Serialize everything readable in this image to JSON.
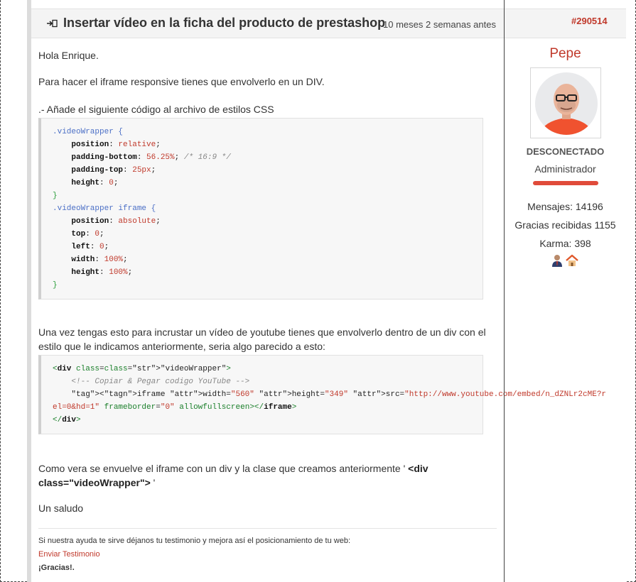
{
  "post": {
    "title": "Insertar vídeo en la ficha del producto de prestashop",
    "date": "10 meses 2 semanas antes",
    "id": "#290514"
  },
  "content": {
    "greeting": "Hola Enrique.",
    "intro": "Para hacer el iframe responsive tienes que envolverlo en un DIV.",
    "step1": ".- Añade el siguiente código al archivo de estilos CSS",
    "css_code": [
      ".videoWrapper {",
      "    position: relative;",
      "    padding-bottom: 56.25%; /* 16:9 */",
      "    padding-top: 25px;",
      "    height: 0;",
      "}",
      ".videoWrapper iframe {",
      "    position: absolute;",
      "    top: 0;",
      "    left: 0;",
      "    width: 100%;",
      "    height: 100%;",
      "}"
    ],
    "step2": "Una vez tengas esto para incrustar un vídeo de youtube tienes que envolverlo dentro de un div con el estilo que le indicamos anteriormente, seria algo parecido a esto:",
    "html_code": [
      "<div class=\"videoWrapper\">",
      "    <!-- Copiar & Pegar codigo YouTube -->",
      "    <iframe width=\"560\" height=\"349\" src=\"http://www.youtube.com/embed/n_dZNLr2cME?r",
      "el=0&hd=1\" frameborder=\"0\" allowfullscreen></iframe>",
      "</div>"
    ],
    "explain_prefix": "Como vera se envuelve el iframe con un div y la clase que creamos anteriormente ' ",
    "explain_bold": "<div class=\"videoWrapper\">",
    "explain_suffix": " '",
    "closing": "Un saludo"
  },
  "signature": {
    "text": "Si nuestra ayuda te sirve déjanos tu testimonio y mejora así el posicionamiento de tu web:",
    "link": "Enviar Testimonio",
    "thanks": "¡Gracias!."
  },
  "author": {
    "name": "Pepe",
    "status": "DESCONECTADO",
    "role": "Administrador",
    "messages": "Mensajes: 14196",
    "thanks_received": "Gracias recibidas 1155",
    "karma": "Karma: 398",
    "badges": [
      "user-icon",
      "home-icon"
    ]
  },
  "colors": {
    "accent": "#c0392b",
    "role_bar": "#e04b3a"
  }
}
